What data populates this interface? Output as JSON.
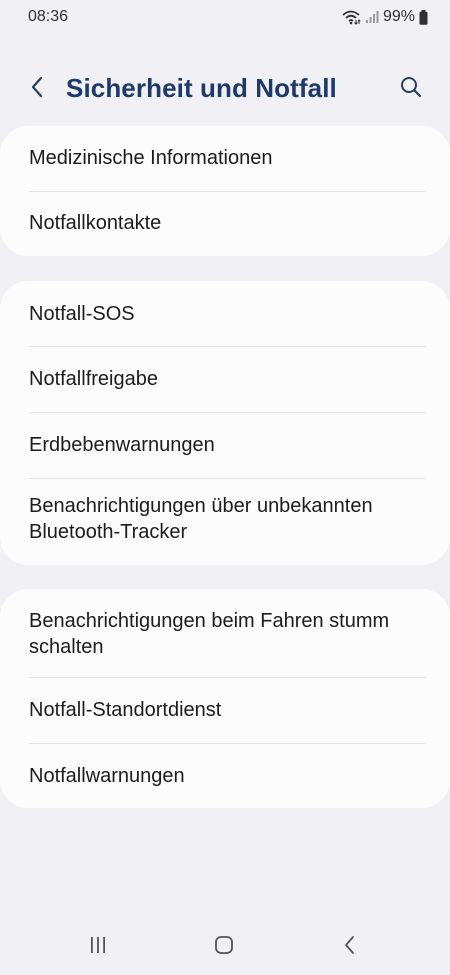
{
  "status_bar": {
    "time": "08:36",
    "battery": "99%"
  },
  "header": {
    "title": "Sicherheit und Notfall"
  },
  "groups": [
    {
      "items": [
        {
          "label": "Medizinische Informationen"
        },
        {
          "label": "Notfallkontakte"
        }
      ]
    },
    {
      "items": [
        {
          "label": "Notfall-SOS"
        },
        {
          "label": "Notfallfreigabe"
        },
        {
          "label": "Erdbebenwarnungen"
        },
        {
          "label": "Benachrichtigungen über unbekannten Bluetooth-Tracker"
        }
      ]
    },
    {
      "items": [
        {
          "label": "Benachrichtigungen beim Fahren stumm schalten"
        },
        {
          "label": "Notfall-Standortdienst"
        },
        {
          "label": "Notfallwarnungen"
        }
      ]
    }
  ],
  "icons": {
    "back": "chevron-left-icon",
    "search": "search-icon",
    "nav_recent": "recent-apps-icon",
    "nav_home": "home-icon",
    "nav_back": "back-icon"
  },
  "colors": {
    "background": "#f1f1f5",
    "card": "#fcfcfc",
    "title": "#1d3a6b",
    "divider": "#e4e4e6"
  }
}
